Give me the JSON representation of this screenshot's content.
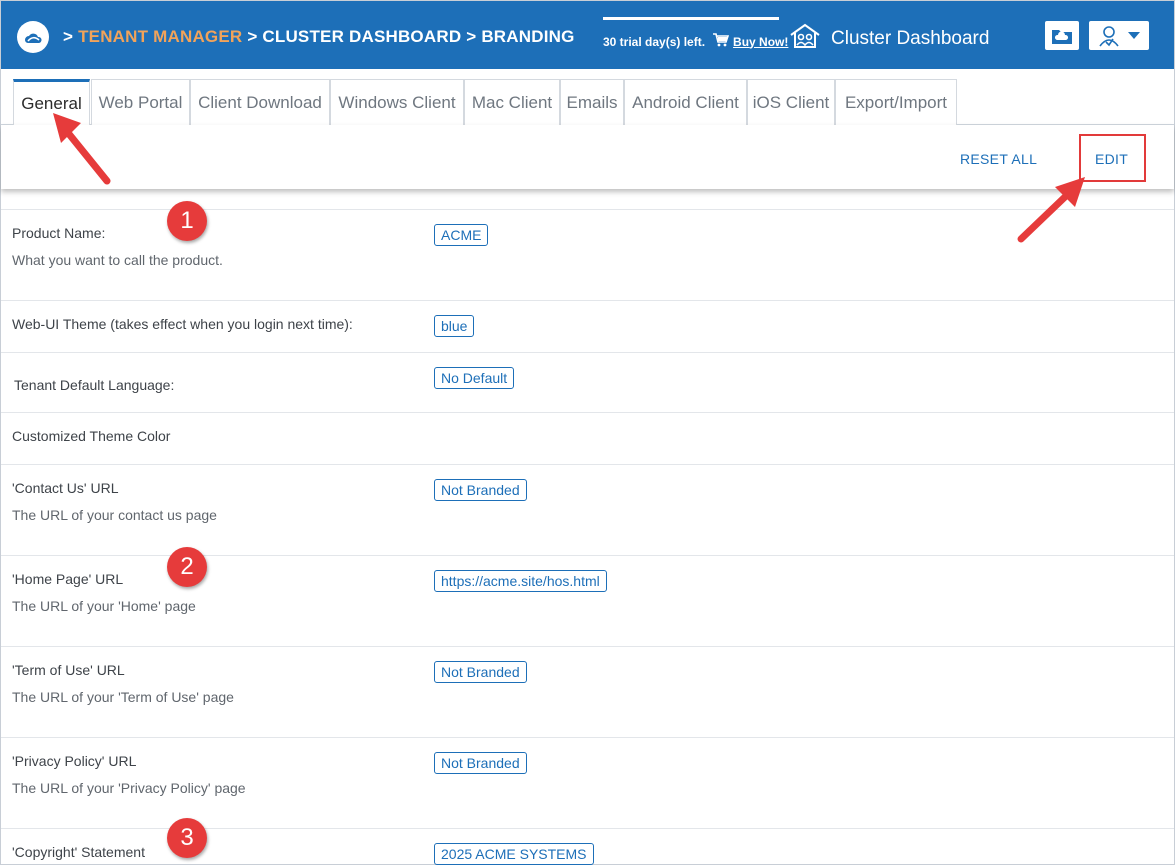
{
  "header": {
    "breadcrumb": [
      {
        "sep": ">",
        "label": "TENANT MANAGER"
      },
      {
        "sep": ">",
        "label": "CLUSTER DASHBOARD"
      },
      {
        "sep": ">",
        "label": "BRANDING"
      }
    ],
    "trial_text": "30 trial day(s) left.",
    "buy_now": "Buy Now!",
    "dashboard_title": "Cluster Dashboard"
  },
  "tabs": [
    {
      "label": "General",
      "active": true
    },
    {
      "label": "Web Portal"
    },
    {
      "label": "Client Download"
    },
    {
      "label": "Windows Client"
    },
    {
      "label": "Mac Client"
    },
    {
      "label": "Emails"
    },
    {
      "label": "Android Client"
    },
    {
      "label": "iOS Client"
    },
    {
      "label": "Export/Import"
    }
  ],
  "toolbar": {
    "reset_all": "RESET ALL",
    "edit": "EDIT"
  },
  "settings": [
    {
      "label": "Product Name:",
      "desc": "What you want to call the product.",
      "value": "ACME"
    },
    {
      "label": "Web-UI Theme (takes effect when you login next time):",
      "value": "blue"
    },
    {
      "label": "Tenant Default Language:",
      "value": "No Default"
    },
    {
      "label": "Customized Theme Color"
    },
    {
      "label": "'Contact Us' URL",
      "desc": "The URL of your contact us page",
      "value": "Not Branded"
    },
    {
      "label": "'Home Page' URL",
      "desc": "The URL of your 'Home' page",
      "value": "https://acme.site/hos.html"
    },
    {
      "label": "'Term of Use' URL",
      "desc": "The URL of your 'Term of Use' page",
      "value": "Not Branded"
    },
    {
      "label": "'Privacy Policy' URL",
      "desc": "The URL of your 'Privacy Policy' page",
      "value": "Not Branded"
    },
    {
      "label": "'Copyright' Statement",
      "value": "2025 ACME SYSTEMS"
    }
  ],
  "annotations": [
    "1",
    "2",
    "3"
  ],
  "colors": {
    "header_bg": "#1d6fb8",
    "accent_orange": "#f1a35a",
    "annotation_red": "#e63b3b",
    "link_blue": "#1d6fb8"
  }
}
